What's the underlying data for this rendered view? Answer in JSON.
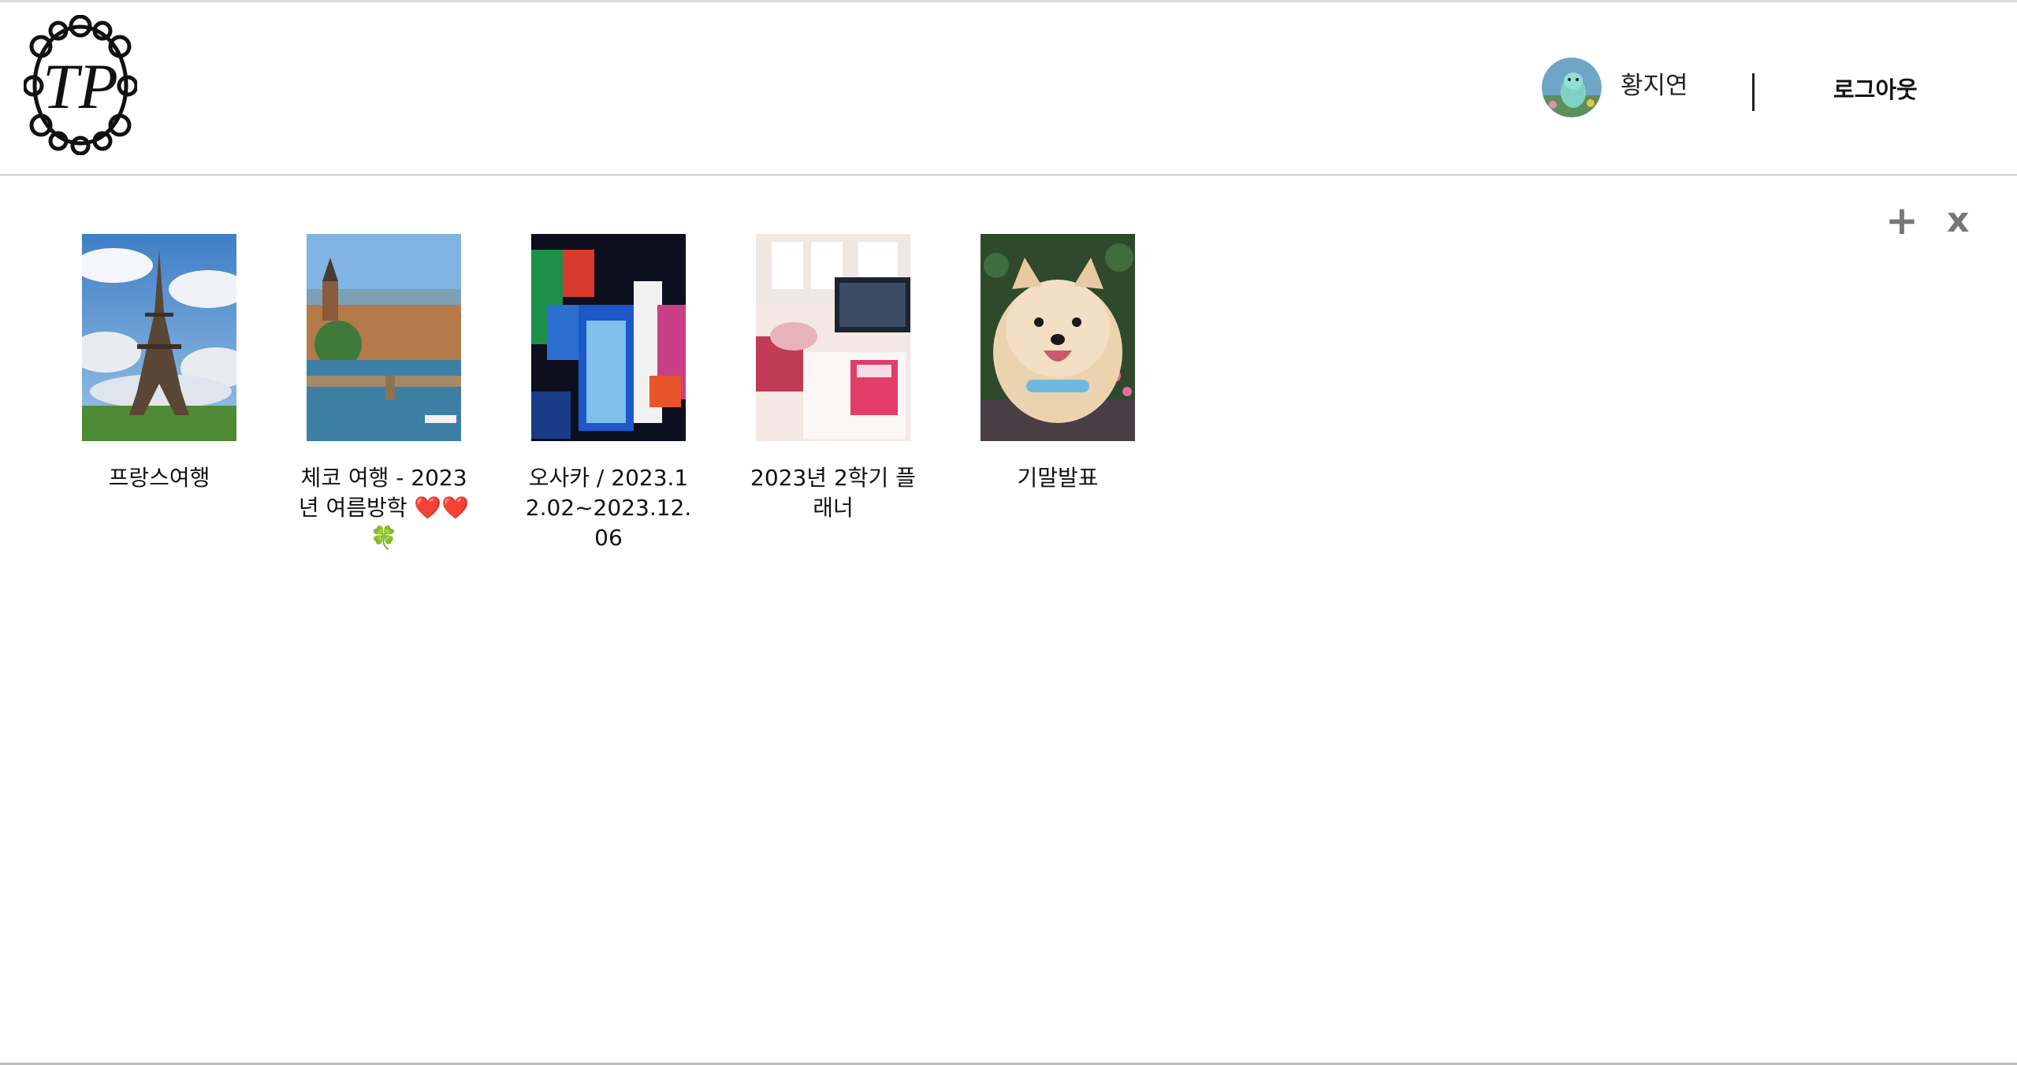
{
  "header": {
    "logo_text": "TP",
    "user_name": "황지연",
    "logout_label": "로그아웃"
  },
  "actions": {
    "add_label": "+",
    "close_label": "x"
  },
  "albums": [
    {
      "title": "프랑스여행",
      "image": "eiffel-tower-photo"
    },
    {
      "title": "체코 여행 - 2023년 여름방학 ❤️❤️🍀",
      "image": "prague-bridge-photo"
    },
    {
      "title": "오사카 / 2023.12.02~2023.12.06",
      "image": "osaka-glico-sign-photo"
    },
    {
      "title": "2023년 2학기 플래너",
      "image": "study-desk-photo"
    },
    {
      "title": "기말발표",
      "image": "pomeranian-dog-photo"
    }
  ]
}
